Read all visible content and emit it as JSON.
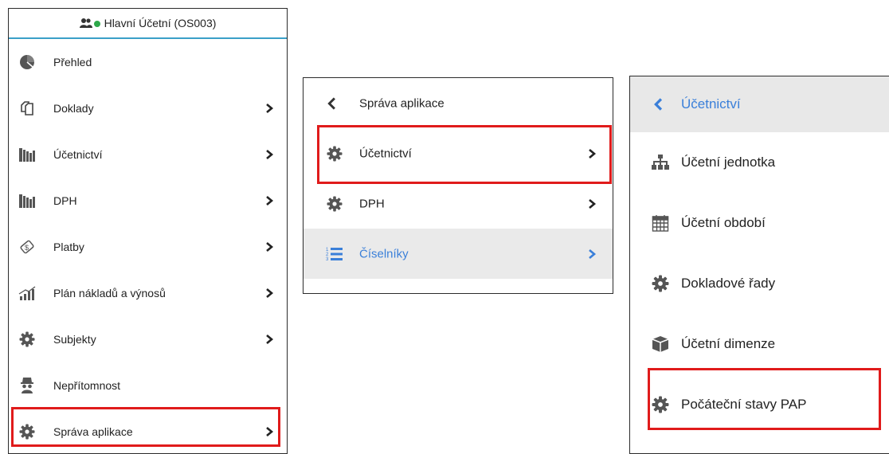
{
  "panel_main": {
    "user_label": "Hlavní Účetní (OS003)",
    "items": [
      {
        "label": "Přehled",
        "icon": "pie-chart-icon",
        "has_chevron": false
      },
      {
        "label": "Doklady",
        "icon": "documents-icon",
        "has_chevron": true
      },
      {
        "label": "Účetnictví",
        "icon": "books-icon",
        "has_chevron": true
      },
      {
        "label": "DPH",
        "icon": "books-icon",
        "has_chevron": true
      },
      {
        "label": "Platby",
        "icon": "payment-icon",
        "has_chevron": true
      },
      {
        "label": "Plán nákladů a výnosů",
        "icon": "signal-chart-icon",
        "has_chevron": true
      },
      {
        "label": "Subjekty",
        "icon": "gear-icon",
        "has_chevron": true
      },
      {
        "label": "Nepřítomnost",
        "icon": "incognito-icon",
        "has_chevron": false
      },
      {
        "label": "Správa aplikace",
        "icon": "gear-icon",
        "has_chevron": true
      }
    ]
  },
  "panel_admin": {
    "back_label": "Správa aplikace",
    "items": [
      {
        "label": "Účetnictví",
        "icon": "gear-icon"
      },
      {
        "label": "DPH",
        "icon": "gear-icon"
      },
      {
        "label": "Číselníky",
        "icon": "numbered-list-icon"
      }
    ]
  },
  "panel_accounting": {
    "back_label": "Účetnictví",
    "items": [
      {
        "label": "Účetní jednotka",
        "icon": "org-chart-icon"
      },
      {
        "label": "Účetní období",
        "icon": "calendar-icon"
      },
      {
        "label": "Dokladové řady",
        "icon": "gear-icon"
      },
      {
        "label": "Účetní dimenze",
        "icon": "cube-icon"
      },
      {
        "label": "Počáteční stavy PAP",
        "icon": "gear-icon"
      }
    ]
  },
  "colors": {
    "accent_blue": "#3a7fd9",
    "highlight_red": "#e01b1b",
    "header_line": "#3aa0c8",
    "status_green": "#2ea84a",
    "icon_gray": "#555555"
  }
}
